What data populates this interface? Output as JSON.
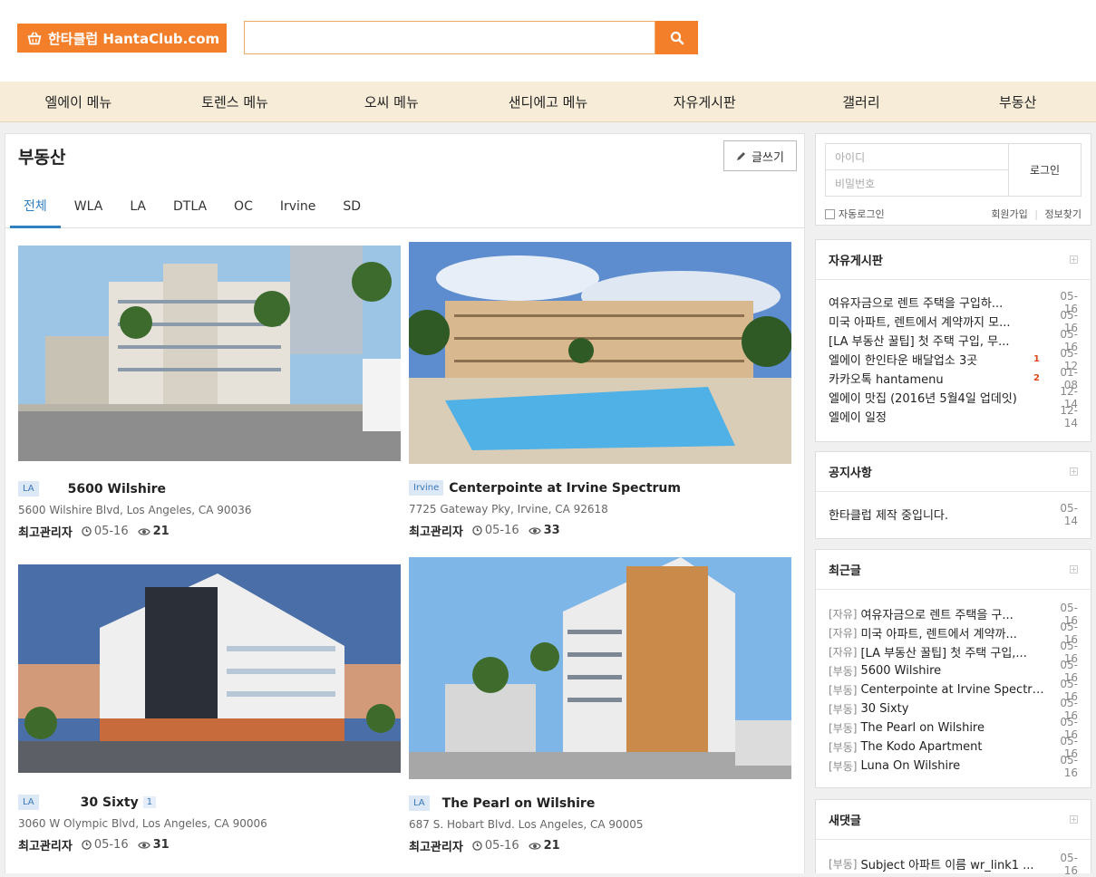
{
  "header": {
    "logo_text": "한타클럽 HantaClub.com",
    "search_value": ""
  },
  "nav": [
    "엘에이 메뉴",
    "토렌스 메뉴",
    "오씨 메뉴",
    "샌디에고 메뉴",
    "자유게시판",
    "갤러리",
    "부동산"
  ],
  "board": {
    "title": "부동산",
    "write_label": "글쓰기",
    "tabs": [
      "전체",
      "WLA",
      "LA",
      "DTLA",
      "OC",
      "Irvine",
      "SD"
    ],
    "active_tab": "전체",
    "cards": [
      {
        "badge": "LA",
        "title": "5600 Wilshire",
        "addr": "5600 Wilshire Blvd, Los Angeles, CA 90036",
        "author": "최고관리자",
        "date": "05-16",
        "views": "21",
        "comments": ""
      },
      {
        "badge": "Irvine",
        "title": "Centerpointe at Irvine Spectrum",
        "addr": "7725 Gateway Pky, Irvine, CA 92618",
        "author": "최고관리자",
        "date": "05-16",
        "views": "33",
        "comments": ""
      },
      {
        "badge": "LA",
        "title": "30 Sixty",
        "addr": "3060 W Olympic Blvd, Los Angeles, CA 90006",
        "author": "최고관리자",
        "date": "05-16",
        "views": "31",
        "comments": "1"
      },
      {
        "badge": "LA",
        "title": "The Pearl on Wilshire",
        "addr": "687 S. Hobart Blvd. Los Angeles, CA 90005",
        "author": "최고관리자",
        "date": "05-16",
        "views": "21",
        "comments": ""
      }
    ]
  },
  "login": {
    "id_placeholder": "아이디",
    "pw_placeholder": "비밀번호",
    "login_label": "로그인",
    "auto_login": "자동로그인",
    "join": "회원가입",
    "find": "정보찾기"
  },
  "free_board": {
    "title": "자유게시판",
    "items": [
      {
        "t": "여유자금으로 렌트 주택을 구입하...",
        "n": "",
        "d": "05-16"
      },
      {
        "t": "미국 아파트, 렌트에서 계약까지 모...",
        "n": "",
        "d": "05-16"
      },
      {
        "t": "[LA 부동산 꿀팁] 첫 주택 구입, 무...",
        "n": "",
        "d": "05-16"
      },
      {
        "t": "엘에이 한인타운 배달업소 3곳",
        "n": "1",
        "d": "05-12"
      },
      {
        "t": "카카오톡 hantamenu",
        "n": "2",
        "d": "01-08"
      },
      {
        "t": "엘에이 맛집 (2016년 5월4일 업데잇)",
        "n": "",
        "d": "12-14"
      },
      {
        "t": "엘에이 일정",
        "n": "",
        "d": "12-14"
      }
    ]
  },
  "notice": {
    "title": "공지사항",
    "items": [
      {
        "t": "한타클럽 제작 중입니다.",
        "d": "05-14"
      }
    ]
  },
  "recent": {
    "title": "최근글",
    "items": [
      {
        "c": "[자유]",
        "t": "여유자금으로 렌트 주택을 구...",
        "d": "05-16"
      },
      {
        "c": "[자유]",
        "t": "미국 아파트, 렌트에서 계약까...",
        "d": "05-16"
      },
      {
        "c": "[자유]",
        "t": "[LA 부동산 꿀팁] 첫 주택 구입,...",
        "d": "05-16"
      },
      {
        "c": "[부동]",
        "t": "5600 Wilshire",
        "d": "05-16"
      },
      {
        "c": "[부동]",
        "t": "Centerpointe at Irvine Spectrum",
        "d": "05-16"
      },
      {
        "c": "[부동]",
        "t": "30 Sixty",
        "d": "05-16"
      },
      {
        "c": "[부동]",
        "t": "The Pearl on Wilshire",
        "d": "05-16"
      },
      {
        "c": "[부동]",
        "t": "The Kodo Apartment",
        "d": "05-16"
      },
      {
        "c": "[부동]",
        "t": "Luna On Wilshire",
        "d": "05-16"
      }
    ]
  },
  "comments": {
    "title": "새댓글",
    "items": [
      {
        "c": "[부동]",
        "t": "Subject 아파트 이름 wr_link1 ...",
        "d": "05-16"
      }
    ]
  }
}
